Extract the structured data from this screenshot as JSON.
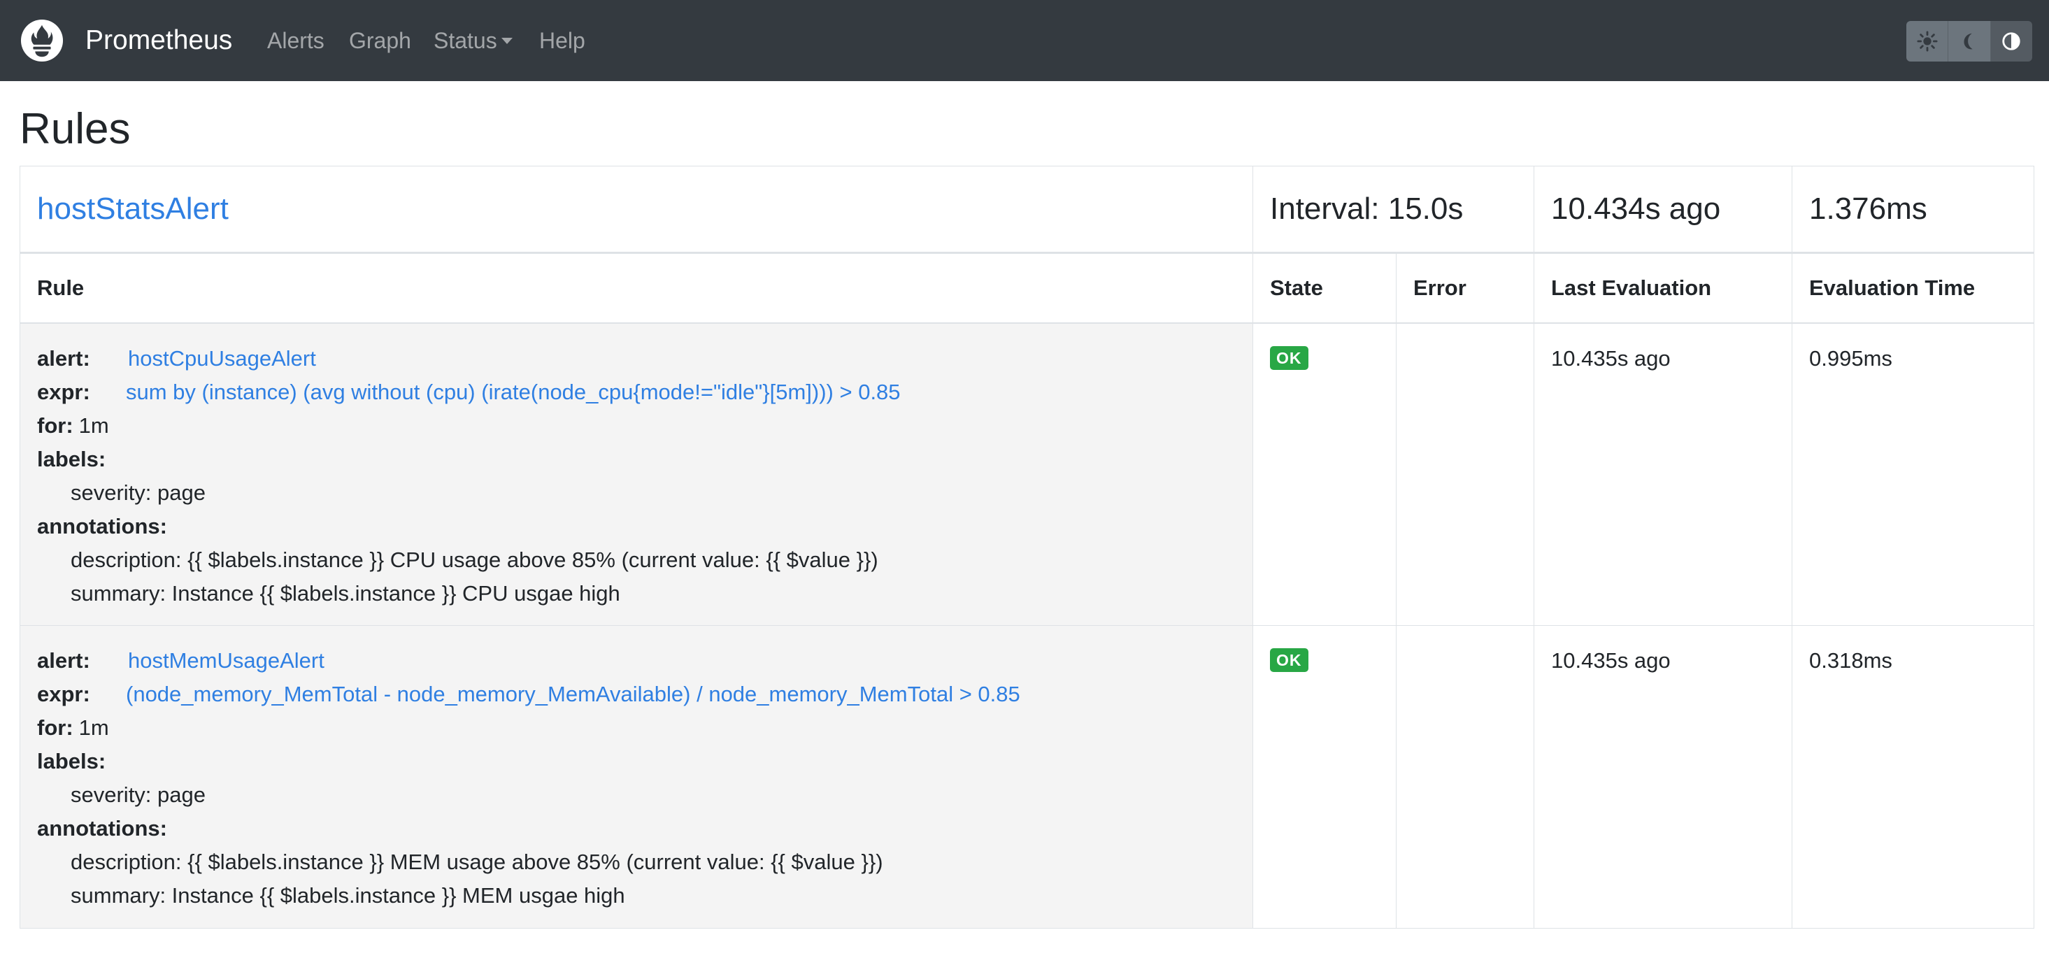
{
  "navbar": {
    "brand": "Prometheus",
    "links": {
      "alerts": "Alerts",
      "graph": "Graph",
      "status": "Status",
      "help": "Help"
    },
    "theme_buttons": [
      "sun-icon",
      "moon-icon",
      "contrast-icon"
    ],
    "background_color": "#343a40"
  },
  "page": {
    "title": "Rules"
  },
  "group": {
    "name": "hostStatsAlert",
    "interval": "Interval: 15.0s",
    "last_evaluation": "10.434s ago",
    "evaluation_time": "1.376ms"
  },
  "columns": {
    "rule": "Rule",
    "state": "State",
    "error": "Error",
    "last_evaluation": "Last Evaluation",
    "evaluation_time": "Evaluation Time"
  },
  "rules": [
    {
      "alert_key": "alert:",
      "alert": "hostCpuUsageAlert",
      "expr_key": "expr:",
      "expr": "sum by (instance) (avg without (cpu) (irate(node_cpu{mode!=\"idle\"}[5m]))) > 0.85",
      "for_key": "for:",
      "for": "1m",
      "labels_key": "labels:",
      "labels": [
        "severity: page"
      ],
      "annotations_key": "annotations:",
      "annotations": [
        "description: {{ $labels.instance }} CPU usage above 85% (current value: {{ $value }})",
        "summary: Instance {{ $labels.instance }} CPU usgae high"
      ],
      "state": "OK",
      "error": "",
      "last_evaluation": "10.435s ago",
      "evaluation_time": "0.995ms"
    },
    {
      "alert_key": "alert:",
      "alert": "hostMemUsageAlert",
      "expr_key": "expr:",
      "expr": "(node_memory_MemTotal - node_memory_MemAvailable) / node_memory_MemTotal > 0.85",
      "for_key": "for:",
      "for": "1m",
      "labels_key": "labels:",
      "labels": [
        "severity: page"
      ],
      "annotations_key": "annotations:",
      "annotations": [
        "description: {{ $labels.instance }} MEM usage above 85% (current value: {{ $value }})",
        "summary: Instance {{ $labels.instance }} MEM usgae high"
      ],
      "state": "OK",
      "error": "",
      "last_evaluation": "10.435s ago",
      "evaluation_time": "0.318ms"
    }
  ],
  "colors": {
    "link": "#2f7fe2",
    "ok_badge": "#28a745",
    "rule_cell_bg": "#f4f4f4"
  }
}
